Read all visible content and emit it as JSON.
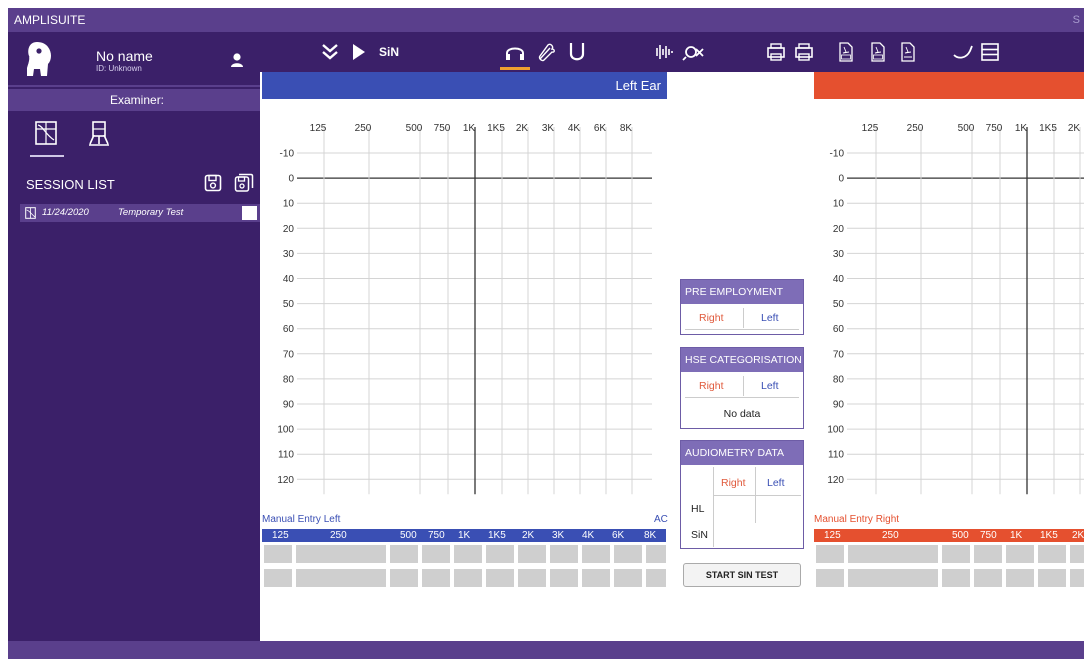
{
  "app": {
    "title": "AMPLISUITE",
    "title_right": "S"
  },
  "patient": {
    "name": "No name",
    "id": "ID: Unknown"
  },
  "examiner": {
    "label": "Examiner:"
  },
  "session_list": {
    "title": "SESSION LIST",
    "items": [
      {
        "date": "11/24/2020",
        "name": "Temporary Test",
        "checked": false
      }
    ]
  },
  "toolbar": {
    "sin_label": "SiN"
  },
  "left_ear": {
    "header": "Left Ear",
    "color": "#3a4fb4"
  },
  "right_ear": {
    "header": "",
    "color": "#e5502f"
  },
  "audiogram": {
    "freq_labels": [
      "125",
      "250",
      "500",
      "750",
      "1K",
      "1K5",
      "2K",
      "3K",
      "4K",
      "6K",
      "8K"
    ],
    "right_visible_freq_labels": [
      "125",
      "250",
      "500",
      "750",
      "1K",
      "1K5",
      "2K"
    ],
    "db_labels": [
      "-10",
      "0",
      "10",
      "20",
      "30",
      "40",
      "50",
      "60",
      "70",
      "80",
      "90",
      "100",
      "110",
      "120"
    ]
  },
  "manual_entry_left": {
    "label": "Manual Entry Left",
    "ac_label": "AC",
    "band_labels": [
      "125",
      "250",
      "500",
      "750",
      "1K",
      "1K5",
      "2K",
      "3K",
      "4K",
      "6K",
      "8K"
    ]
  },
  "manual_entry_right": {
    "label": "Manual Entry Right",
    "band_labels": [
      "125",
      "250",
      "500",
      "750",
      "1K",
      "1K5",
      "2K"
    ]
  },
  "pre_employment": {
    "title": "PRE EMPLOYMENT",
    "right": "Right",
    "left": "Left"
  },
  "hse": {
    "title": "HSE CATEGORISATION",
    "right": "Right",
    "left": "Left",
    "no_data": "No data"
  },
  "audiometry": {
    "title": "AUDIOMETRY DATA",
    "right": "Right",
    "left": "Left",
    "row_hl": "HL",
    "row_sin": "SiN"
  },
  "start_sin_test": {
    "label": "START SIN TEST"
  },
  "colors": {
    "sidebar": "#3b2069",
    "titlebar": "#5a3f8c",
    "accent_orange": "#f0a030",
    "panel_purple": "#7e6db7"
  }
}
